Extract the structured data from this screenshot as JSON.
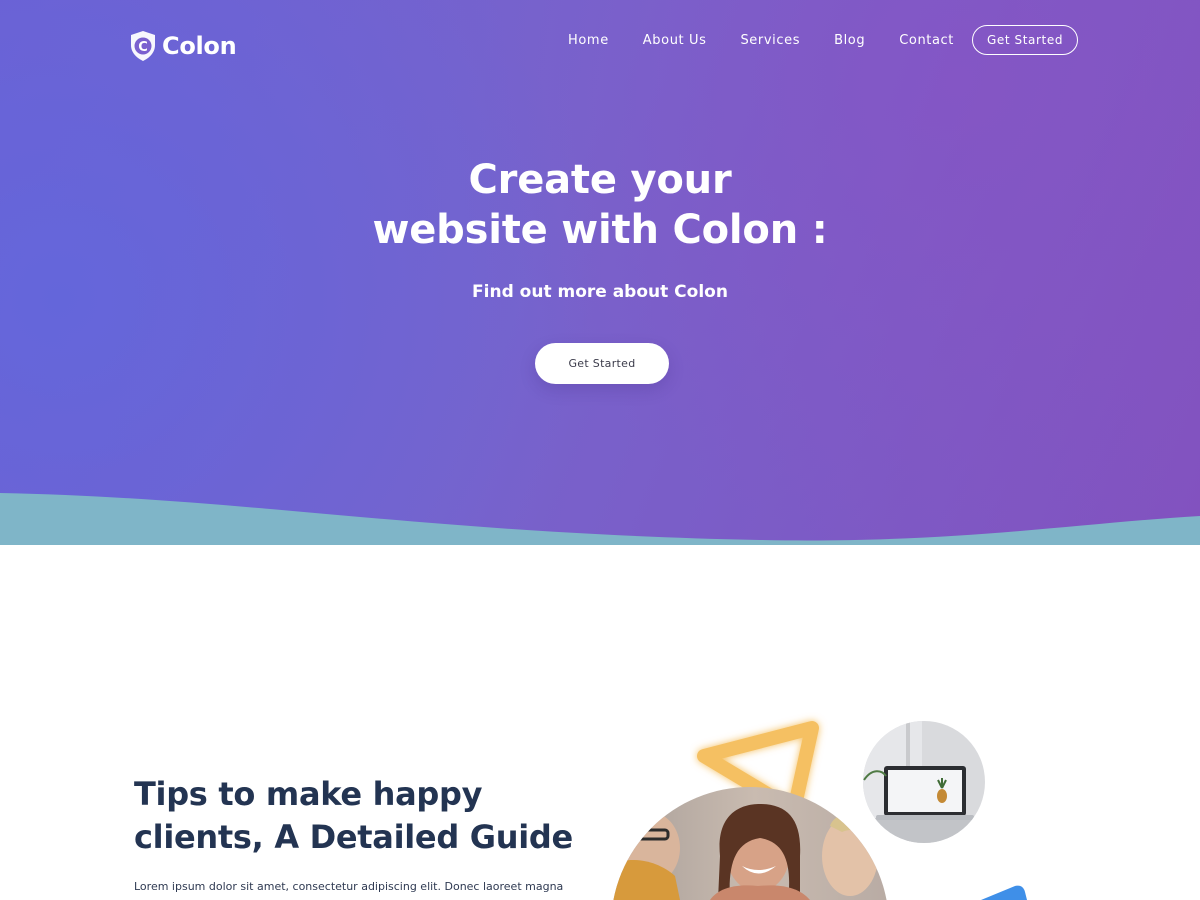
{
  "brand": {
    "name": "Colon",
    "logo_icon": "shield-c-icon",
    "logo_letter": "C"
  },
  "nav": {
    "links": [
      "Home",
      "About Us",
      "Services",
      "Blog",
      "Contact"
    ],
    "cta_label": "Get Started"
  },
  "hero": {
    "title_line1": "Create your",
    "title_line2": "website with Colon :",
    "subtitle": "Find out more about Colon",
    "cta_label": "Get Started"
  },
  "section": {
    "title_line1": "Tips to make happy",
    "title_line2": "clients, A Detailed Guide",
    "body": "Lorem ipsum dolor sit amet, consectetur adipiscing elit. Donec laoreet magna"
  },
  "colors": {
    "hero_gradient_start": "#6f60d2",
    "hero_gradient_end": "#8252bf",
    "wave": "#7fb5c8",
    "heading_dark": "#233452",
    "triangle_accent": "#f5c062",
    "blue_accent": "#3f8fe8"
  },
  "decor": {
    "triangle": "triangle-outline-icon",
    "main_photo": "team-photo",
    "round_photo": "laptop-photo",
    "blue_shape": "blue-shape-icon"
  }
}
